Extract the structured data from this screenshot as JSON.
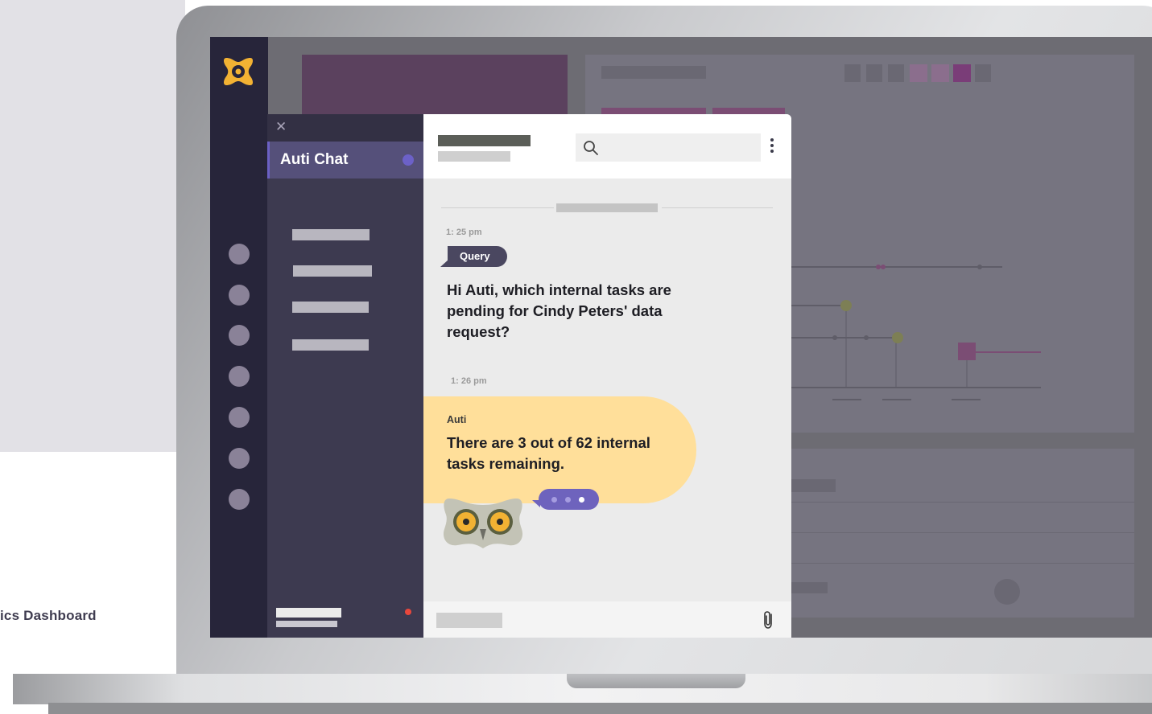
{
  "background": {
    "caption": "ics Dashboard"
  },
  "rail": {
    "logo": "auti-logo-icon",
    "nav_dot_count": 7
  },
  "chat_list": {
    "close_icon": "close-icon",
    "active_item": {
      "label": "Auti Chat"
    }
  },
  "chat": {
    "header": {
      "search_icon": "search-icon",
      "more_icon": "more-vertical-icon"
    },
    "query": {
      "time": "1: 25 pm",
      "tag": "Query",
      "text": "Hi Auti, which internal tasks are pending for Cindy Peters' data request?"
    },
    "reply": {
      "time": "1: 26 pm",
      "sender": "Auti",
      "text": "There are 3 out of 62 internal tasks remaining."
    },
    "composer": {
      "attach_icon": "paperclip-icon"
    }
  },
  "colors": {
    "rail": "#27253a",
    "chat_list": "#3d3a50",
    "accent": "#6c61c8",
    "reply_bubble": "#ffdf9a",
    "query_tag": "#4a4760",
    "notification": "#e8473c"
  }
}
